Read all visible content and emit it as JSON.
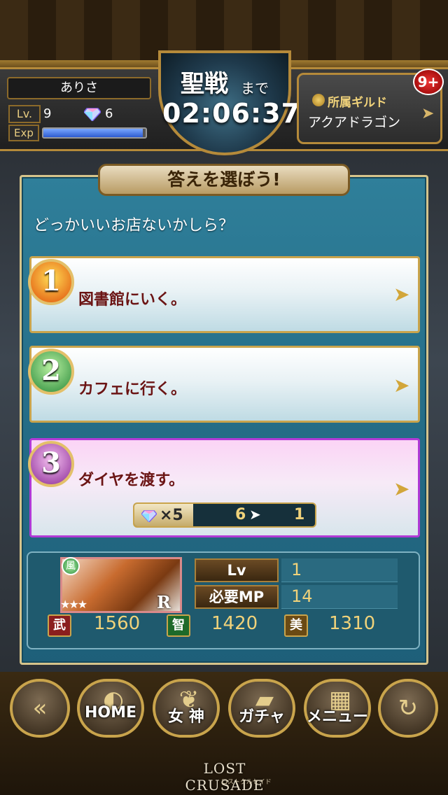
{
  "header": {
    "player_name": "ありさ",
    "level_label": "Lv.",
    "level": "9",
    "gems": "6",
    "exp_label": "Exp",
    "exp_fraction": 0.97,
    "event_title": "聖戦",
    "event_suffix": "まで",
    "countdown": "02:06:37",
    "guild_label": "所属ギルド",
    "guild_name": "アクアドラゴン",
    "notification_count": "9+"
  },
  "panel": {
    "title": "答えを選ぼう!",
    "question": "どっかいいお店ないかしら？",
    "choices": [
      {
        "number": "1",
        "text": "図書館にいく。"
      },
      {
        "number": "2",
        "text": "カフェに行く。"
      },
      {
        "number": "3",
        "text": "ダイヤを渡す。"
      }
    ],
    "cost": {
      "times": "×5",
      "have": "6",
      "after": "1"
    }
  },
  "card": {
    "attribute": "風",
    "stars": "★★★",
    "rarity": "R",
    "lv_label": "Lv",
    "lv_value": "1",
    "mp_label": "必要MP",
    "mp_value": "14",
    "atk_label": "武",
    "atk_value": "1560",
    "int_label": "智",
    "int_value": "1420",
    "bea_label": "美",
    "bea_value": "1310"
  },
  "nav": {
    "home": "HOME",
    "goddess": "女 神",
    "gacha": "ガチャ",
    "menu": "メニュー"
  },
  "logo": {
    "title": "LOST CRUSADE",
    "subtitle": "ロストクルセイド"
  },
  "colors": {
    "panel": "#256d87",
    "gold": "#c9a44c",
    "choice3_border": "#b03ad6"
  }
}
